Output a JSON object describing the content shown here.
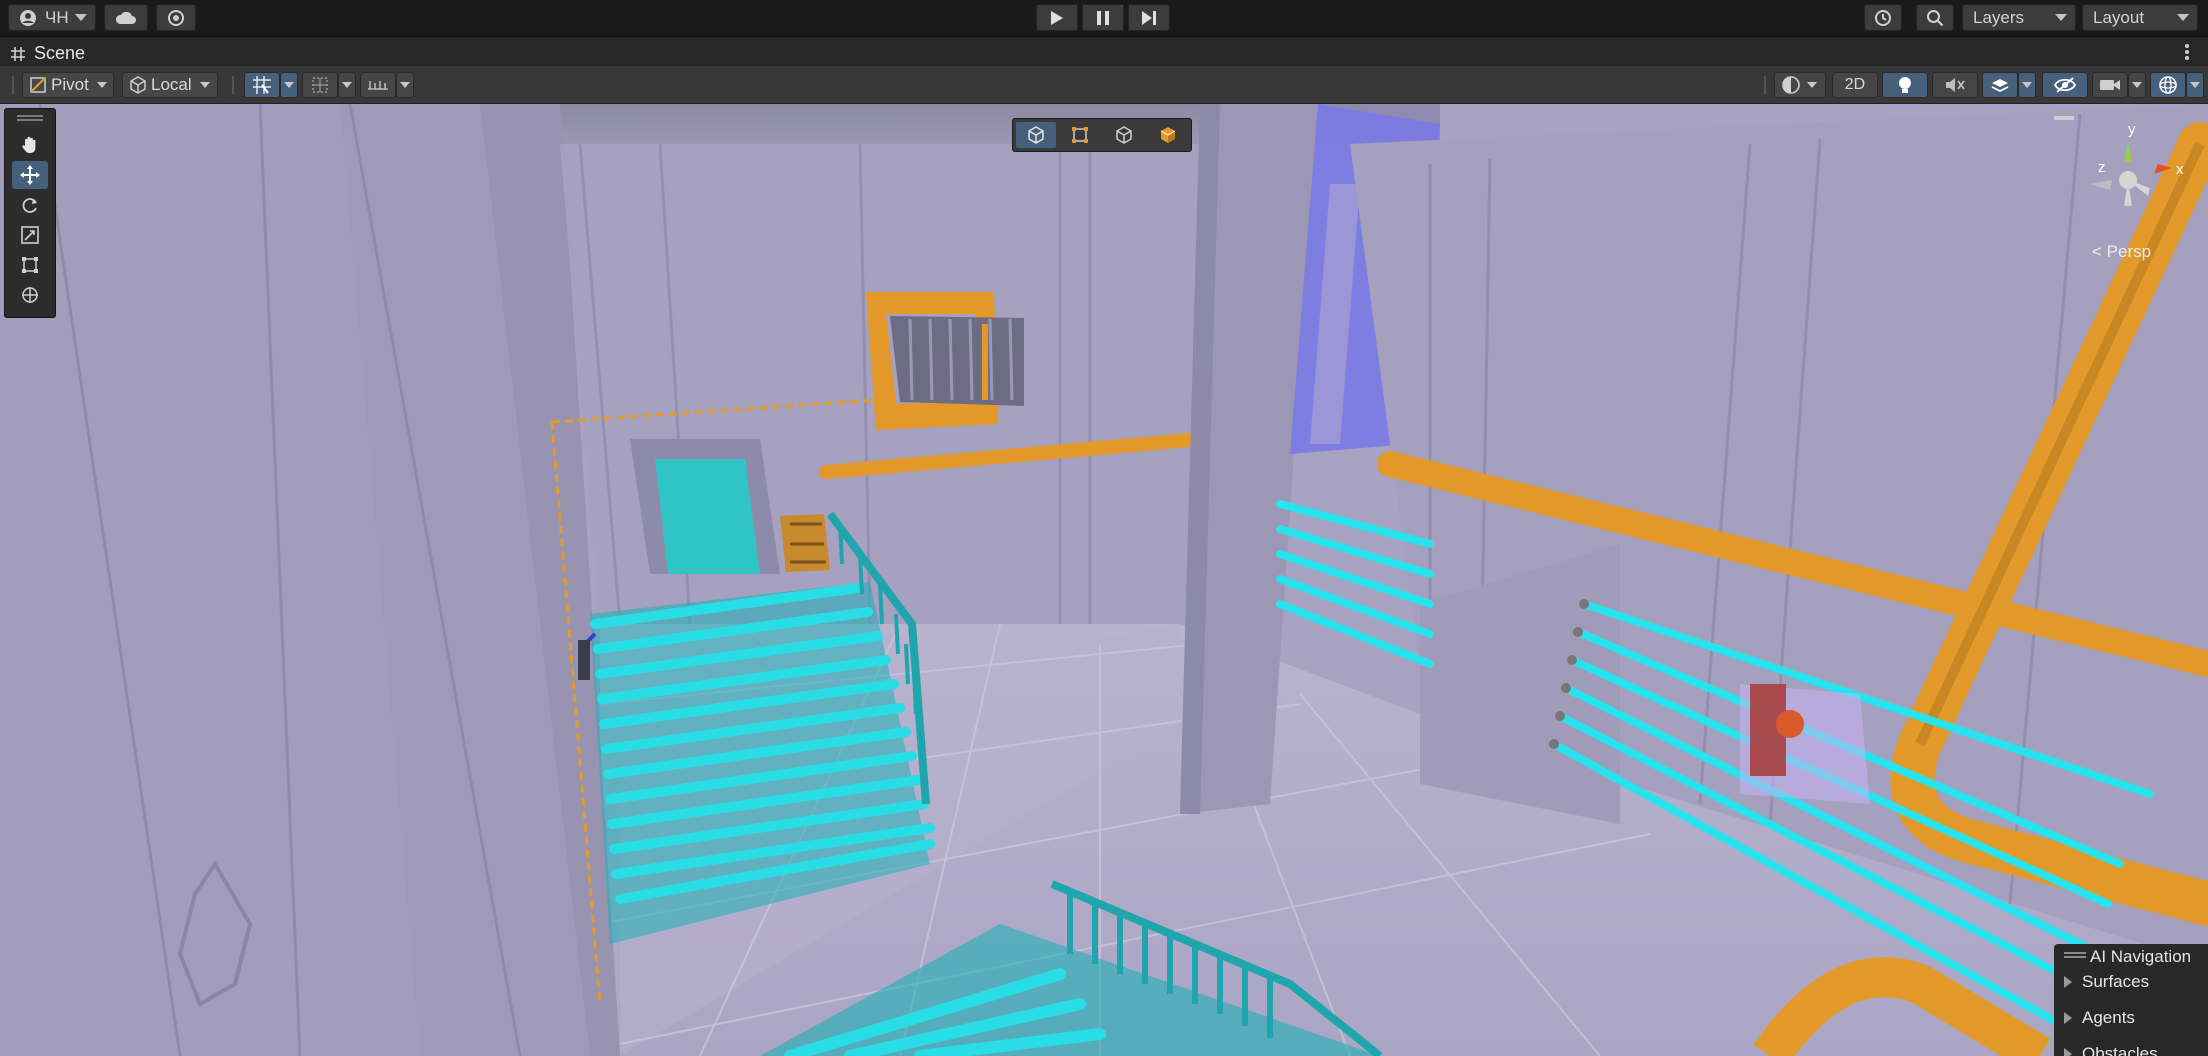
{
  "topbar": {
    "account_label": "ЧН",
    "layers_label": "Layers",
    "layout_label": "Layout"
  },
  "scene_tab": {
    "title": "Scene"
  },
  "scene_toolbar": {
    "pivot_label": "Pivot",
    "local_label": "Local",
    "mode_2d_label": "2D"
  },
  "gizmo": {
    "y_label": "y",
    "x_label": "x",
    "z_label": "z",
    "projection_label": "< Persp"
  },
  "ai_navigation": {
    "title": "AI Navigation",
    "items": [
      {
        "label": "Surfaces"
      },
      {
        "label": "Agents"
      },
      {
        "label": "Obstacles"
      }
    ]
  },
  "colors": {
    "accent_blue": "#46607c",
    "orange_pipe": "#e39a2a",
    "cyan_rail": "#27e3ee",
    "wall": "#a39fbd"
  }
}
